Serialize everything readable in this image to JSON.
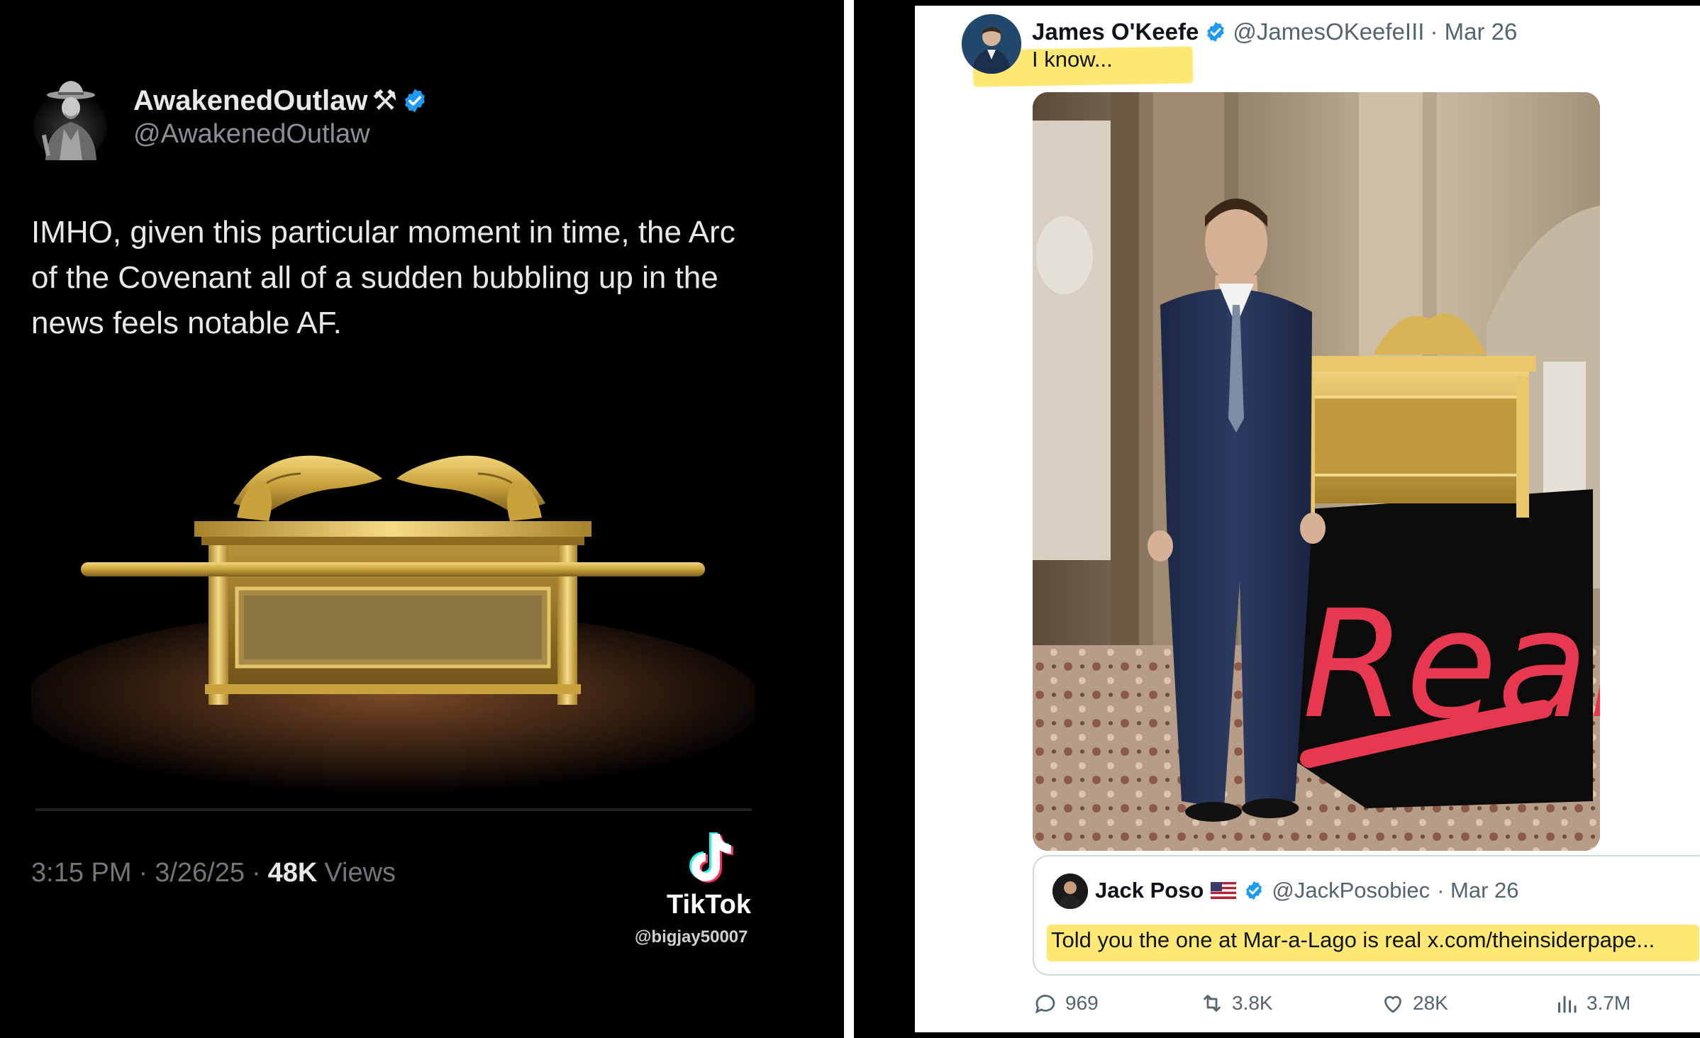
{
  "left_tweet": {
    "display_name": "AwakenedOutlaw",
    "name_emoji": "⚒",
    "handle": "@AwakenedOutlaw",
    "body": "IMHO, given this particular moment in time, the Arc of the Covenant all of a sudden bubbling up in the news feels notable AF.",
    "time": "3:15 PM",
    "date": "3/26/25",
    "views_count": "48K",
    "views_label": "Views",
    "separator": "·",
    "verified_color": "#1d9bf0"
  },
  "watermark": {
    "brand": "TikTok",
    "username": "@bigjay50007"
  },
  "right_tweet": {
    "display_name": "James O'Keefe",
    "handle": "@JamesOKeefeIII",
    "date": "· Mar 26",
    "reply_text": "I know...",
    "photo_annotation": "Real",
    "annotation_color": "#e8384f",
    "highlight_color": "#ffd600",
    "quote": {
      "display_name": "Jack Poso",
      "handle": "@JackPosobiec",
      "date": "· Mar 26",
      "text": "Told you the one at Mar-a-Lago is real x.com/theinsiderpape..."
    },
    "actions": {
      "replies": "969",
      "reposts": "3.8K",
      "likes": "28K",
      "views": "3.7M"
    }
  }
}
